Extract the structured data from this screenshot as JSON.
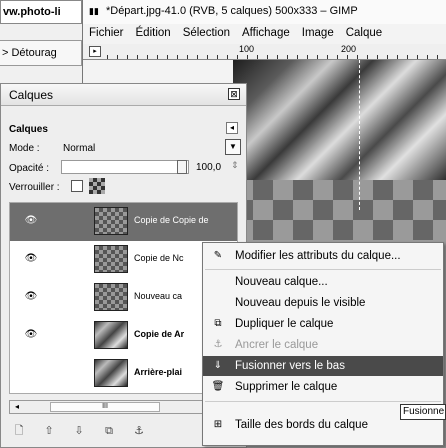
{
  "browser": {
    "url_fragment": "vw.photo-li",
    "tab_fragment": "> Détourag"
  },
  "gimp": {
    "window_title": "*Départ.jpg-41.0 (RVB, 5 calques) 500x333 – GIMP",
    "menu": [
      "Fichier",
      "Édition",
      "Sélection",
      "Affichage",
      "Image",
      "Calque"
    ],
    "ruler_labels": [
      "100",
      "200"
    ]
  },
  "dock": {
    "title": "Calques",
    "panel_header": "Calques",
    "mode_label": "Mode :",
    "mode_value": "Normal",
    "opacity_label": "Opacité :",
    "opacity_value": "100,0",
    "opacity_fraction": 1.0,
    "lock_label": "Verrouiller :",
    "layers": [
      {
        "name": "Copie de Copie de",
        "selected": true,
        "visible": true,
        "thumb": "checker"
      },
      {
        "name": "Copie de Nc",
        "selected": false,
        "visible": true,
        "thumb": "checker"
      },
      {
        "name": "Nouveau ca",
        "selected": false,
        "visible": true,
        "thumb": "checker"
      },
      {
        "name": "Copie de Ar",
        "selected": false,
        "visible": true,
        "thumb": "photo"
      },
      {
        "name": "Arrière-plai",
        "selected": false,
        "visible": false,
        "thumb": "photo"
      }
    ],
    "scroll_thumb_label": "III"
  },
  "context_menu": {
    "items": [
      {
        "label": "Modifier les attributs du calque...",
        "icon": "edit-icon",
        "glyph": "✎",
        "state": "normal"
      },
      {
        "label": "Nouveau calque...",
        "icon": "",
        "glyph": "",
        "state": "normal"
      },
      {
        "label": "Nouveau depuis le visible",
        "icon": "",
        "glyph": "",
        "state": "normal"
      },
      {
        "label": "Dupliquer le calque",
        "icon": "duplicate-icon",
        "glyph": "⧉",
        "state": "normal"
      },
      {
        "label": "Ancrer le calque",
        "icon": "anchor-icon",
        "glyph": "⚓",
        "state": "disabled"
      },
      {
        "label": "Fusionner vers le bas",
        "icon": "merge-down-icon",
        "glyph": "⇓",
        "state": "highlighted"
      },
      {
        "label": "Supprimer le calque",
        "icon": "delete-icon",
        "glyph": "🗑",
        "state": "normal"
      },
      {
        "label": "Taille des bords du calque",
        "icon": "resize-icon",
        "glyph": "⊞",
        "state": "normal"
      }
    ]
  },
  "tooltip": "Fusionne",
  "colors": {
    "selected_row": "#6e6e6e",
    "highlighted_menu_item": "#4a4a4a"
  }
}
